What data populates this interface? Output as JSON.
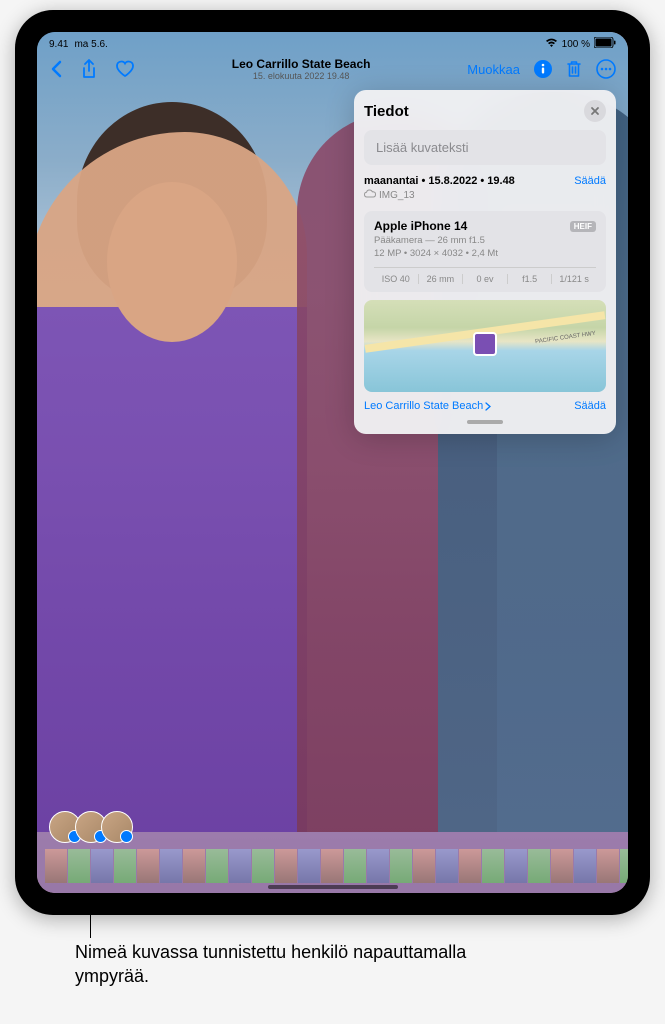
{
  "status": {
    "time": "9.41",
    "date": "ma 5.6.",
    "battery": "100 %"
  },
  "header": {
    "title": "Leo Carrillo State Beach",
    "subtitle": "15. elokuuta 2022 19.48",
    "edit_label": "Muokkaa"
  },
  "info": {
    "panel_title": "Tiedot",
    "caption_placeholder": "Lisää kuvateksti",
    "date_line": "maanantai • 15.8.2022 • 19.48",
    "filename": "IMG_13",
    "adjust_label": "Säädä",
    "camera_model": "Apple iPhone 14",
    "format_badge": "HEIF",
    "lens_line": "Pääkamera — 26 mm f1.5",
    "res_line": "12 MP • 3024 × 4032 • 2,4 Mt",
    "exif": {
      "iso": "ISO 40",
      "focal": "26 mm",
      "ev": "0 ev",
      "aperture": "f1.5",
      "shutter": "1/121 s"
    },
    "map_road": "PACIFIC COAST HWY",
    "map_location": "Leo Carrillo State Beach",
    "map_adjust": "Säädä"
  },
  "callout_text": "Nimeä kuvassa tunnistettu henkilö napauttamalla ympyrää."
}
